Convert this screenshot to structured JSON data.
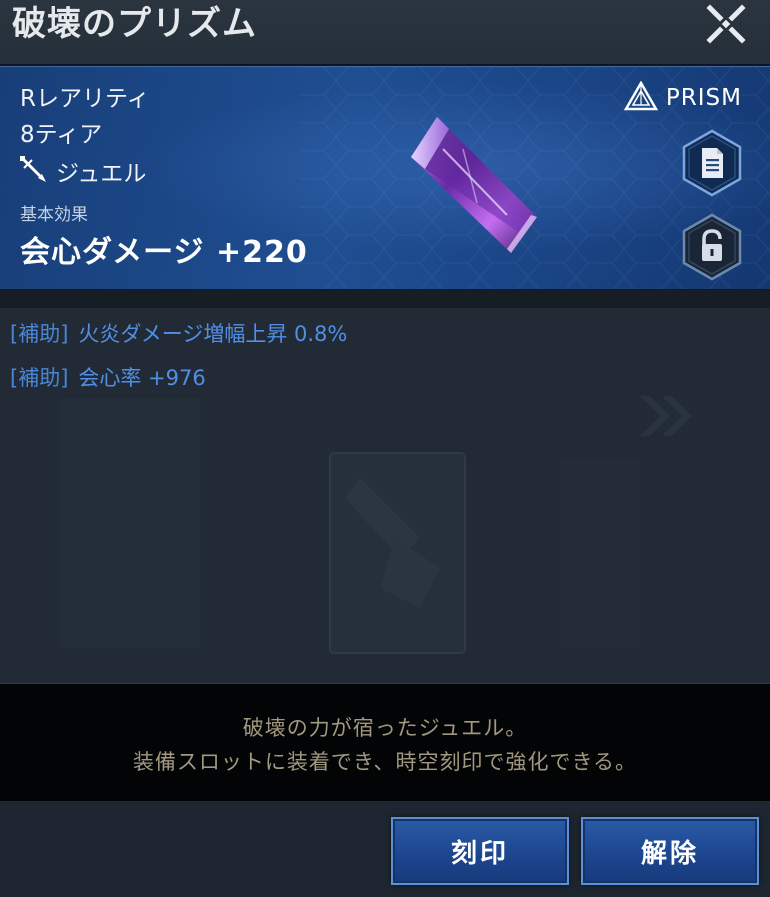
{
  "header": {
    "title": "破壊のプリズム",
    "close_icon": "close-x-icon"
  },
  "item": {
    "rarity": "Rレアリティ",
    "tier": "8ティア",
    "type_label": "ジュエル",
    "type_icon": "jewel-sword-icon",
    "base_effect_label": "基本効果",
    "base_effect_value": "会心ダメージ +220",
    "badge_label": "PRISM",
    "badge_icon": "prism-triangle-icon",
    "side_buttons": [
      "document-icon",
      "lock-open-icon"
    ]
  },
  "sub_effects": [
    {
      "tag": "[補助]",
      "text": "火炎ダメージ増幅上昇 0.8%"
    },
    {
      "tag": "[補助]",
      "text": "会心率 +976"
    }
  ],
  "description": {
    "line1": "破壊の力が宿ったジュエル。",
    "line2": "装備スロットに装着でき、時空刻印で強化できる。"
  },
  "buttons": {
    "engrave_label": "刻印",
    "release_label": "解除"
  },
  "colors": {
    "panel_blue": "#1f4f92",
    "sub_effect_blue": "#4f8fe6",
    "description_text": "#a19880",
    "button_blue": "#1d4690"
  }
}
